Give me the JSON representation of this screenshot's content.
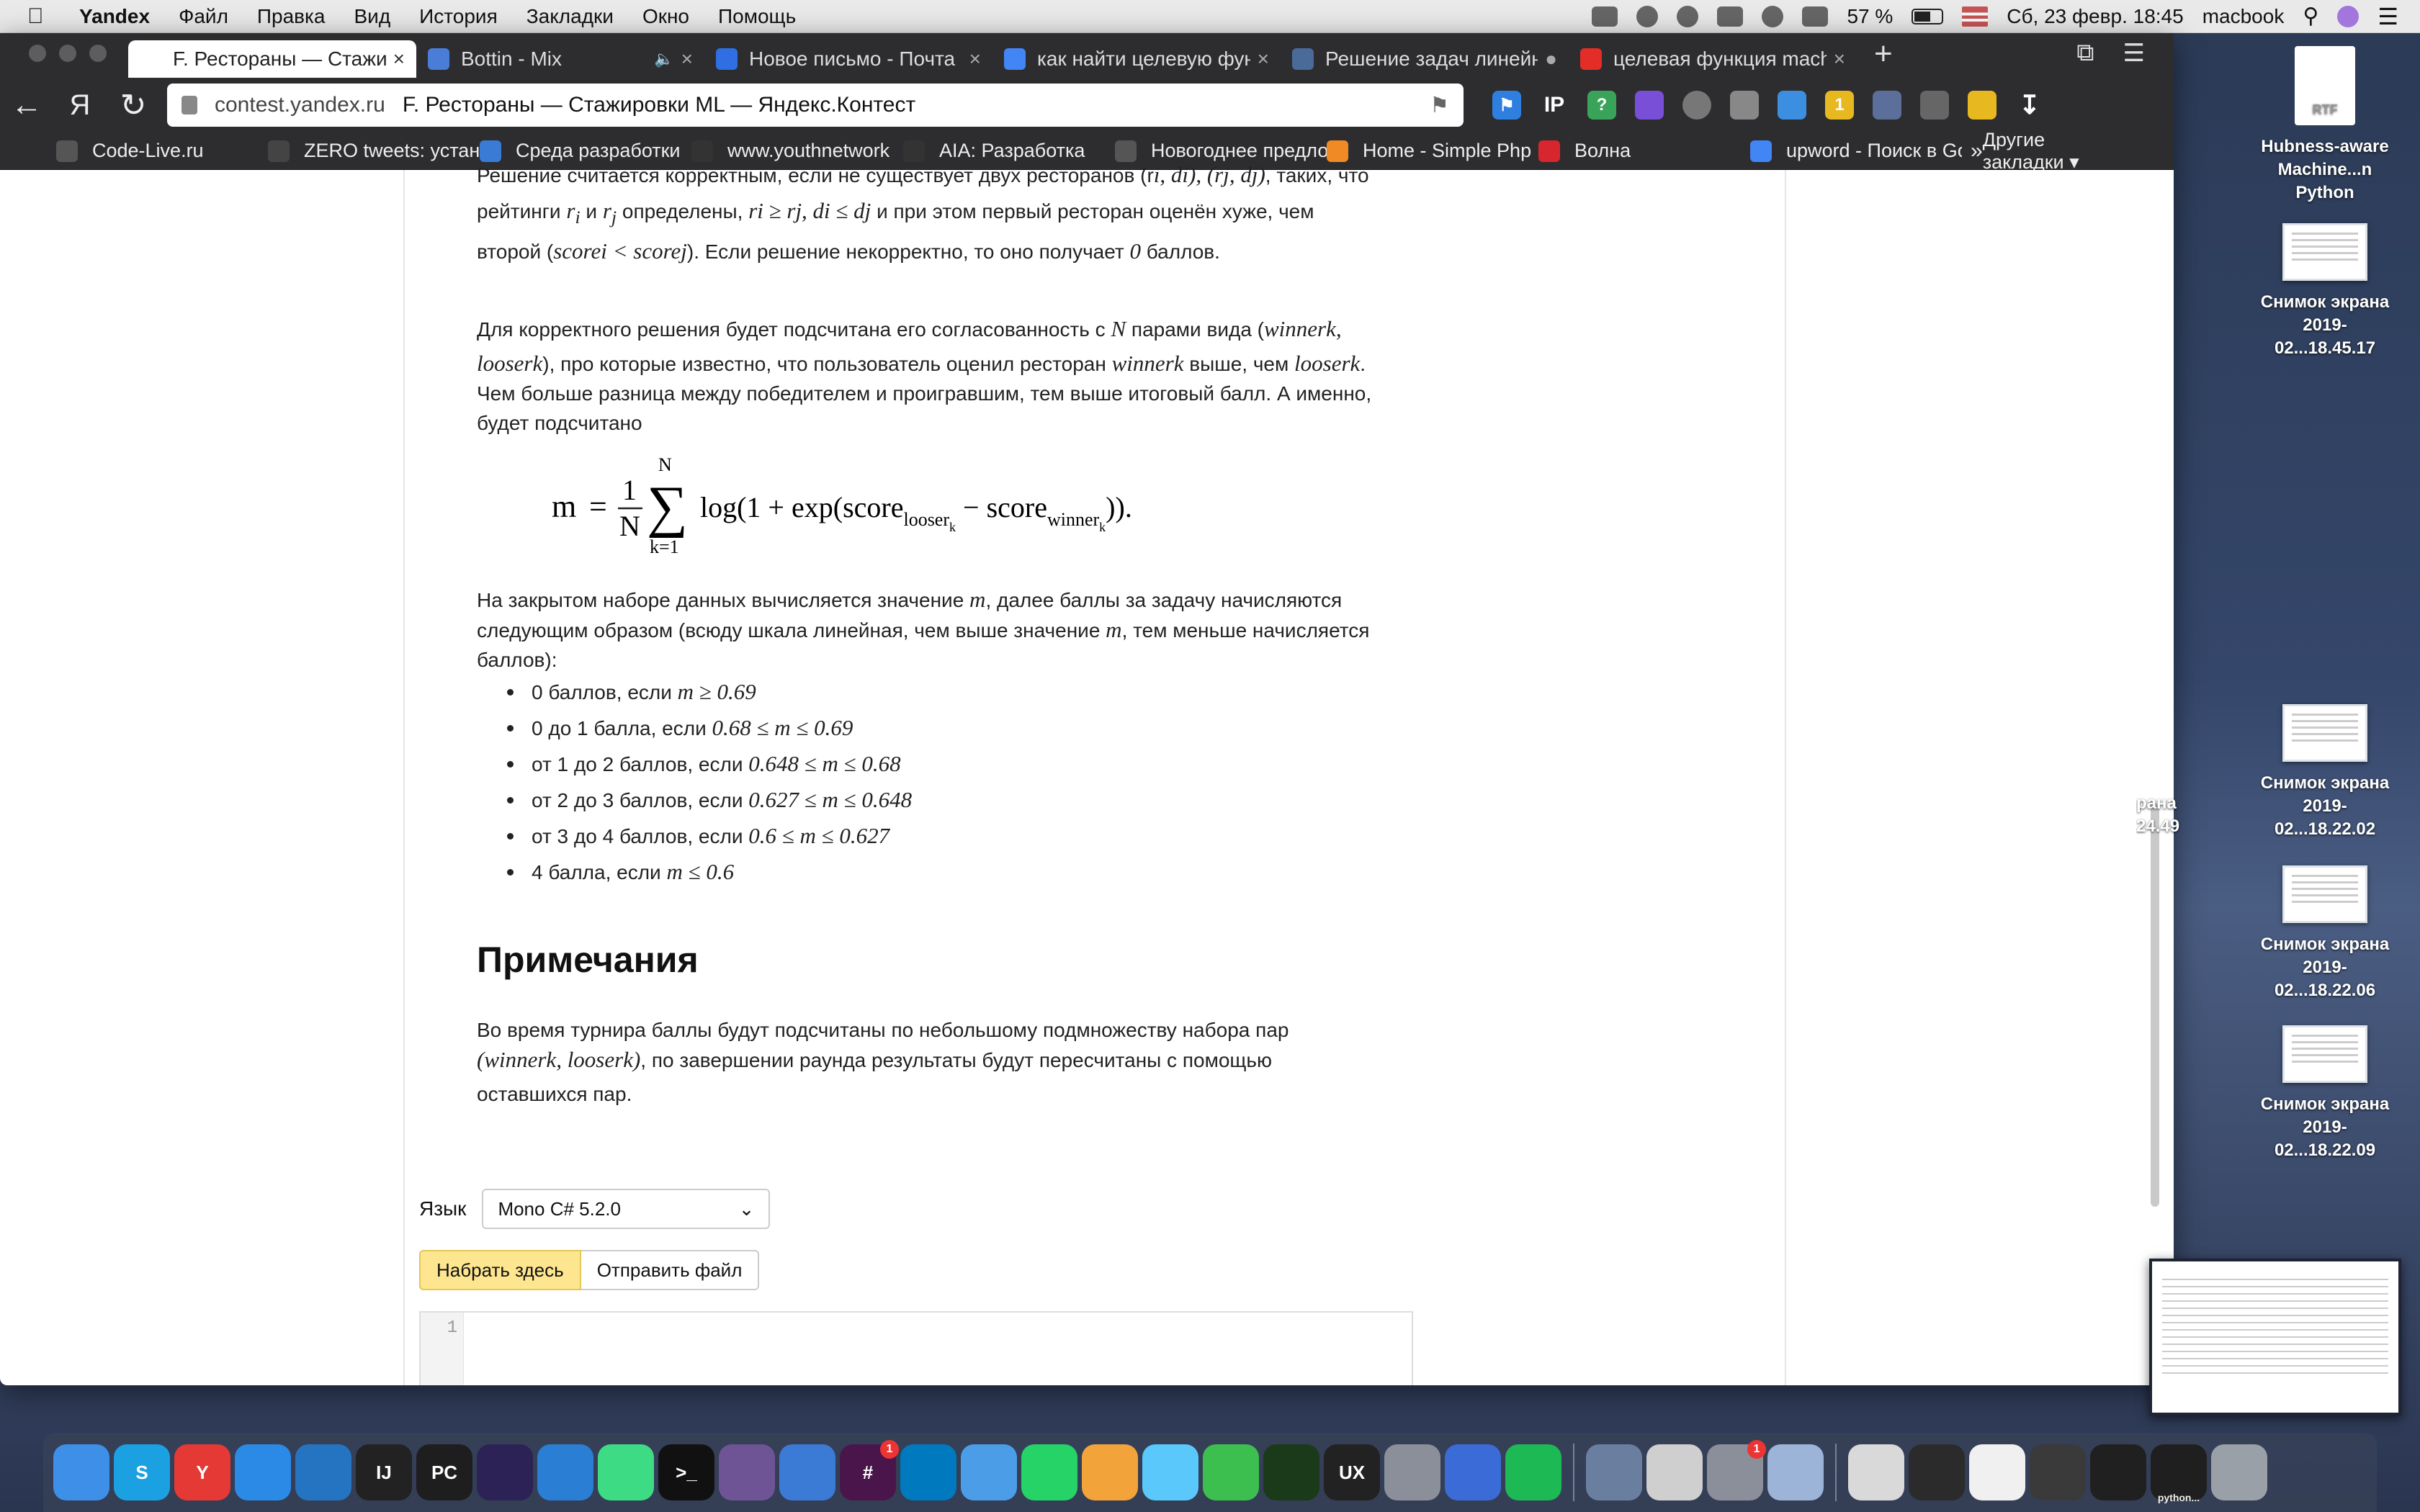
{
  "menubar": {
    "app_name": "Yandex",
    "menus": [
      "Файл",
      "Правка",
      "Вид",
      "История",
      "Закладки",
      "Окно",
      "Помощь"
    ],
    "battery": "57 %",
    "datetime": "Сб, 23 февр.  18:45",
    "user": "macbook"
  },
  "tabs": [
    {
      "title": "F. Рестораны — Стажировки ML",
      "icon": "yandex-icon",
      "color": "#ffffff",
      "active": true
    },
    {
      "title": "Bottin - Mix",
      "icon": "play-icon",
      "color": "#4a7dd8",
      "active": false
    },
    {
      "title": "Новое письмо - Почта Mail.ru",
      "icon": "mail-icon",
      "color": "#2f6fe3",
      "active": false
    },
    {
      "title": "как найти целевую функцию",
      "icon": "google-icon",
      "color": "#4285f4",
      "active": false
    },
    {
      "title": "Решение задач линейного",
      "icon": "h-icon",
      "color": "#4a6a9a",
      "active": false
    },
    {
      "title": "целевая функция machine",
      "icon": "youtube-icon",
      "color": "#e52d27",
      "active": false
    }
  ],
  "address": {
    "host": "contest.yandex.ru",
    "page_title": "F. Рестораны — Стажировки ML — Яндекс.Контест"
  },
  "bookmarks": [
    {
      "label": "Code-Live.ru",
      "color": "#555555"
    },
    {
      "label": "ZERO tweets: установка",
      "color": "#444444"
    },
    {
      "label": "Среда разработки",
      "color": "#3a7bd5"
    },
    {
      "label": "www.youthnetwork",
      "color": "#333333"
    },
    {
      "label": "AIA: Разработка",
      "color": "#333333"
    },
    {
      "label": "Новогоднее предложение",
      "color": "#555555"
    },
    {
      "label": "Home - Simple Php",
      "color": "#f08a24"
    },
    {
      "label": "Волна",
      "color": "#d8262e"
    },
    {
      "label": "upword - Поиск в Google",
      "color": "#4285f4"
    }
  ],
  "bookmarks_more": "»",
  "bookmarks_other": "Другие закладки ▾",
  "content": {
    "p1_line1": "Решение считается корректным, если не существует двух ресторанов (r",
    "p1_vars1": "i, di), (rj, dj)",
    "p1_line1_end": ", таких, что",
    "p1_line2_a": "рейтинги ",
    "p1_ri": "r",
    "p1_line2_b": " и ",
    "p1_line2_c": " определены, ",
    "p1_cond": "ri ≥ rj, di ≤ dj",
    "p1_line2_d": " и при этом первый ресторан оценён хуже, чем",
    "p1_line3_a": "второй (",
    "p1_score": "scorei < scorej",
    "p1_line3_b": "). Если решение некорректно, то оно получает ",
    "p1_zero": "0",
    "p1_line3_c": " баллов.",
    "p2_a": "Для корректного решения будет подсчитана его согласованность с ",
    "p2_N": "N",
    "p2_b": " парами вида (",
    "p2_pair1": "winnerk,",
    "p2_pair2": "looserk",
    "p2_c": "), про которые известно, что пользователь оценил ресторан ",
    "p2_w": "winnerk",
    "p2_d": " выше, чем ",
    "p2_l": "looserk",
    "p2_e": ".",
    "p2_line3": "Чем больше разница между победителем и проигравшим, тем выше итоговый балл. А именно,",
    "p2_line4": "будет подсчитано",
    "p3_line1_a": "На закрытом наборе данных вычисляется значение ",
    "p3_m": "m",
    "p3_line1_b": ", далее баллы за задачу начисляются",
    "p3_line2_a": "следующим образом (всюду шкала линейная, чем выше значение ",
    "p3_line2_b": ", тем меньше начисляется",
    "p3_line3": "баллов):",
    "score_rules": [
      {
        "text": "0 баллов, если ",
        "cond": "m ≥ 0.69"
      },
      {
        "text": "0 до 1 балла, если ",
        "cond": "0.68 ≤ m ≤ 0.69"
      },
      {
        "text": "от 1 до 2 баллов, если ",
        "cond": "0.648 ≤ m ≤ 0.68"
      },
      {
        "text": "от 2 до 3 баллов, если ",
        "cond": "0.627 ≤ m ≤ 0.648"
      },
      {
        "text": "от 3 до 4 баллов, если ",
        "cond": "0.6 ≤ m ≤ 0.627"
      },
      {
        "text": "4 балла, если ",
        "cond": "m ≤ 0.6"
      }
    ],
    "notes_heading": "Примечания",
    "notes_line1": "Во время турнира баллы будут подсчитаны по небольшому подмножеству набора пар",
    "notes_line2_pair": "(winnerk, looserk)",
    "notes_line2_rest": ", по завершении раунда результаты будут пересчитаны с помощью",
    "notes_line3": "оставшихся пар."
  },
  "formula": {
    "lhs": "m",
    "eq": "=",
    "frac_num": "1",
    "frac_den": "N",
    "sum_top": "N",
    "sum_bottom": "k=1",
    "body": "log(1 + exp(score",
    "sub1": "looser",
    "sub1k": "k",
    "minus": " − score",
    "sub2": "winner",
    "sub2k": "k",
    "close": ")).",
    "sigma": "∑"
  },
  "submit": {
    "lang_label": "Язык",
    "lang_value": "Mono C# 5.2.0",
    "type_here": "Набрать здесь",
    "send_file": "Отправить файл",
    "line_number": "1"
  },
  "desktop": [
    {
      "label": "Hubness-aware Machine...n Python",
      "kind": "doc",
      "badge": "RTF"
    },
    {
      "label": "Снимок экрана 2019-02...18.45.17",
      "kind": "thumb"
    },
    {
      "label": "Снимок экрана 2019-02...18.22.02",
      "kind": "thumb"
    },
    {
      "label": "Снимок экрана 2019-02...18.22.06",
      "kind": "thumb"
    },
    {
      "label": "Снимок экрана 2019-02...18.22.09",
      "kind": "thumb"
    }
  ],
  "desktop_partial": {
    "line1": "рана",
    "line2": "24.49"
  },
  "dock": [
    {
      "name": "finder-icon",
      "color": "#3d8fe8",
      "glyph": ""
    },
    {
      "name": "skype-icon",
      "color": "#1ba1e2",
      "glyph": "S"
    },
    {
      "name": "yandex-browser-icon",
      "color": "#e53935",
      "glyph": "Y"
    },
    {
      "name": "safari-icon",
      "color": "#2b8ae6",
      "glyph": ""
    },
    {
      "name": "vscode-icon",
      "color": "#2474c2",
      "glyph": ""
    },
    {
      "name": "intellij-icon",
      "color": "#222222",
      "glyph": "IJ"
    },
    {
      "name": "pycharm-icon",
      "color": "#1e1e1e",
      "glyph": "PC"
    },
    {
      "name": "eclipse-icon",
      "color": "#2c2255",
      "glyph": ""
    },
    {
      "name": "xcode-icon",
      "color": "#2a7fd4",
      "glyph": ""
    },
    {
      "name": "android-studio-icon",
      "color": "#3ddc84",
      "glyph": ""
    },
    {
      "name": "terminal-icon",
      "color": "#111111",
      "glyph": ">_"
    },
    {
      "name": "github-icon",
      "color": "#6e5494",
      "glyph": ""
    },
    {
      "name": "keynote-icon",
      "color": "#3b7bd6",
      "glyph": ""
    },
    {
      "name": "slack-icon",
      "color": "#4a154b",
      "glyph": "#",
      "badge": "1"
    },
    {
      "name": "trello-icon",
      "color": "#0079bf",
      "glyph": ""
    },
    {
      "name": "folder-icon",
      "color": "#4c9de8",
      "glyph": ""
    },
    {
      "name": "whatsapp-icon",
      "color": "#25d366",
      "glyph": ""
    },
    {
      "name": "photos-icon",
      "color": "#f2a33a",
      "glyph": ""
    },
    {
      "name": "messages-icon",
      "color": "#5ac8fa",
      "glyph": ""
    },
    {
      "name": "facetime-icon",
      "color": "#3dbf4f",
      "glyph": ""
    },
    {
      "name": "spinner-app-icon",
      "color": "#1a3a1a",
      "glyph": ""
    },
    {
      "name": "uxpin-icon",
      "color": "#222222",
      "glyph": "UX"
    },
    {
      "name": "system-prefs-icon",
      "color": "#8a8f99",
      "glyph": ""
    },
    {
      "name": "charts-icon",
      "color": "#3b6bd6",
      "glyph": ""
    },
    {
      "name": "spotify-icon",
      "color": "#1db954",
      "glyph": ""
    },
    {
      "name": "database-icon",
      "color": "#6a7fa0",
      "glyph": ""
    },
    {
      "name": "script-editor-icon",
      "color": "#cfcfcf",
      "glyph": ""
    },
    {
      "name": "app-store-icon",
      "color": "#8a8f99",
      "glyph": "",
      "badge": "1"
    },
    {
      "name": "preview-icon",
      "color": "#9bb4d8",
      "glyph": ""
    },
    {
      "name": "downloads-stack-icon",
      "color": "#d9d9d9",
      "glyph": ""
    },
    {
      "name": "stack-icon-1",
      "color": "#2b2b2b",
      "glyph": ""
    },
    {
      "name": "stack-icon-2",
      "color": "#f0f0f0",
      "glyph": ""
    },
    {
      "name": "stack-icon-3",
      "color": "#3a3a3a",
      "glyph": ""
    },
    {
      "name": "stack-icon-4",
      "color": "#202020",
      "glyph": ""
    },
    {
      "name": "python-window-icon",
      "color": "#1f1f1f",
      "glyph": "",
      "label": "python..."
    },
    {
      "name": "trash-icon",
      "color": "#9aa0a8",
      "glyph": ""
    }
  ]
}
